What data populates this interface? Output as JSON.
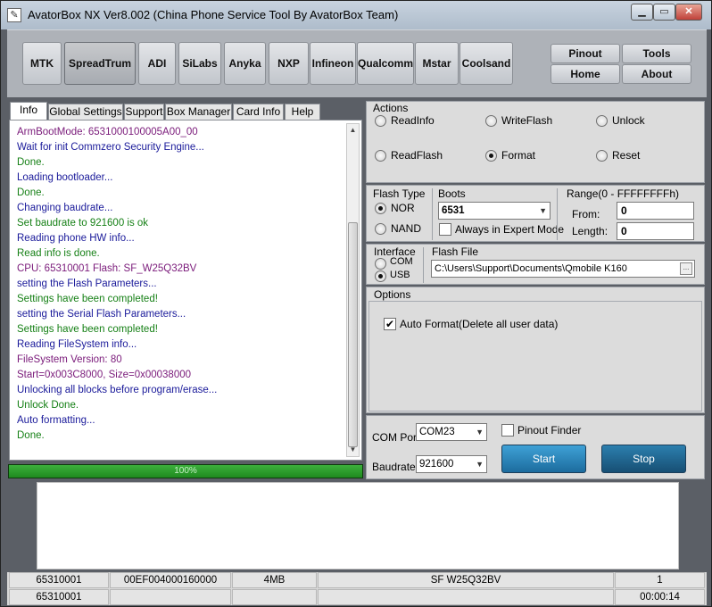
{
  "window": {
    "title": "AvatorBox NX Ver8.002 (China Phone Service Tool By AvatorBox Team)",
    "icon": "app-icon",
    "controls": [
      "minimize-icon",
      "maximize-icon",
      "close-icon"
    ]
  },
  "chips": [
    "MTK",
    "SpreadTrum",
    "ADI",
    "SiLabs",
    "Anyka",
    "NXP",
    "Infineon",
    "Qualcomm",
    "Mstar",
    "Coolsand"
  ],
  "selected_chip": "SpreadTrum",
  "nav": [
    "Pinout",
    "Tools",
    "Home",
    "About"
  ],
  "tabs": [
    "Info",
    "Global Settings",
    "Support",
    "Box Manager",
    "Card Info",
    "Help"
  ],
  "selected_tab": "Info",
  "log": [
    {
      "text": "ArmBootMode: 6531000100005A00_00",
      "color": "purple"
    },
    {
      "text": "Wait for init Commzero Security Engine...",
      "color": "blue"
    },
    {
      "text": "Done.",
      "color": "green"
    },
    {
      "text": "Loading bootloader...",
      "color": "blue"
    },
    {
      "text": "Done.",
      "color": "green"
    },
    {
      "text": "Changing baudrate...",
      "color": "blue"
    },
    {
      "text": "Set baudrate to 921600 is ok",
      "color": "green"
    },
    {
      "text": "Reading phone HW info...",
      "color": "blue"
    },
    {
      "text": "Read info is done.",
      "color": "green"
    },
    {
      "text": "CPU: 65310001      Flash: SF_W25Q32BV",
      "color": "purple"
    },
    {
      "text": "setting the Flash Parameters...",
      "color": "blue"
    },
    {
      "text": "Settings have been completed!",
      "color": "green"
    },
    {
      "text": "setting the Serial Flash Parameters...",
      "color": "blue"
    },
    {
      "text": "Settings have been completed!",
      "color": "green"
    },
    {
      "text": "Reading FileSystem info...",
      "color": "blue"
    },
    {
      "text": "FileSystem Version: 80",
      "color": "purple"
    },
    {
      "text": "Start=0x003C8000, Size=0x00038000",
      "color": "purple"
    },
    {
      "text": "Unlocking all blocks before program/erase...",
      "color": "blue"
    },
    {
      "text": "Unlock Done.",
      "color": "green"
    },
    {
      "text": "Auto formatting...",
      "color": "blue"
    },
    {
      "text": "Done.",
      "color": "green"
    }
  ],
  "progress": {
    "label": "100%",
    "value": 1.0
  },
  "actions": {
    "title": "Actions",
    "options": [
      "ReadInfo",
      "WriteFlash",
      "Unlock",
      "ReadFlash",
      "Format",
      "Reset"
    ],
    "selected": "Format"
  },
  "flash_type": {
    "title": "Flash Type",
    "options": [
      "NOR",
      "NAND"
    ],
    "selected": "NOR"
  },
  "boots": {
    "title": "Boots",
    "value": "6531",
    "expert_label": "Always in Expert Mode",
    "expert_checked": false
  },
  "range": {
    "title": "Range(0 - FFFFFFFFh)",
    "from_label": "From:",
    "from_value": "0",
    "length_label": "Length:",
    "length_value": "0"
  },
  "interface": {
    "title": "Interface",
    "options": [
      "COM",
      "USB"
    ],
    "selected": "USB"
  },
  "flash_file": {
    "title": "Flash File",
    "value": "C:\\Users\\Support\\Documents\\Qmobile K160",
    "browse_label": "..."
  },
  "options": {
    "title": "Options",
    "auto_format_label": "Auto Format(Delete all user data)",
    "auto_format_checked": true
  },
  "port": {
    "com_label": "COM Port",
    "com_value": "COM23",
    "pinout_finder_label": "Pinout Finder",
    "pinout_finder_checked": false,
    "baud_label": "Baudrate",
    "baud_value": "921600",
    "start_label": "Start",
    "stop_label": "Stop"
  },
  "status": {
    "row1": [
      "65310001",
      "00EF004000160000",
      "4MB",
      "SF  W25Q32BV",
      "1"
    ],
    "row2": [
      "65310001",
      "",
      "",
      "",
      "00:00:14"
    ]
  },
  "colors": {
    "purple": "#7a1a7a",
    "blue": "#1a1a9a",
    "green": "#168016",
    "accent": "#3fa1d6"
  }
}
